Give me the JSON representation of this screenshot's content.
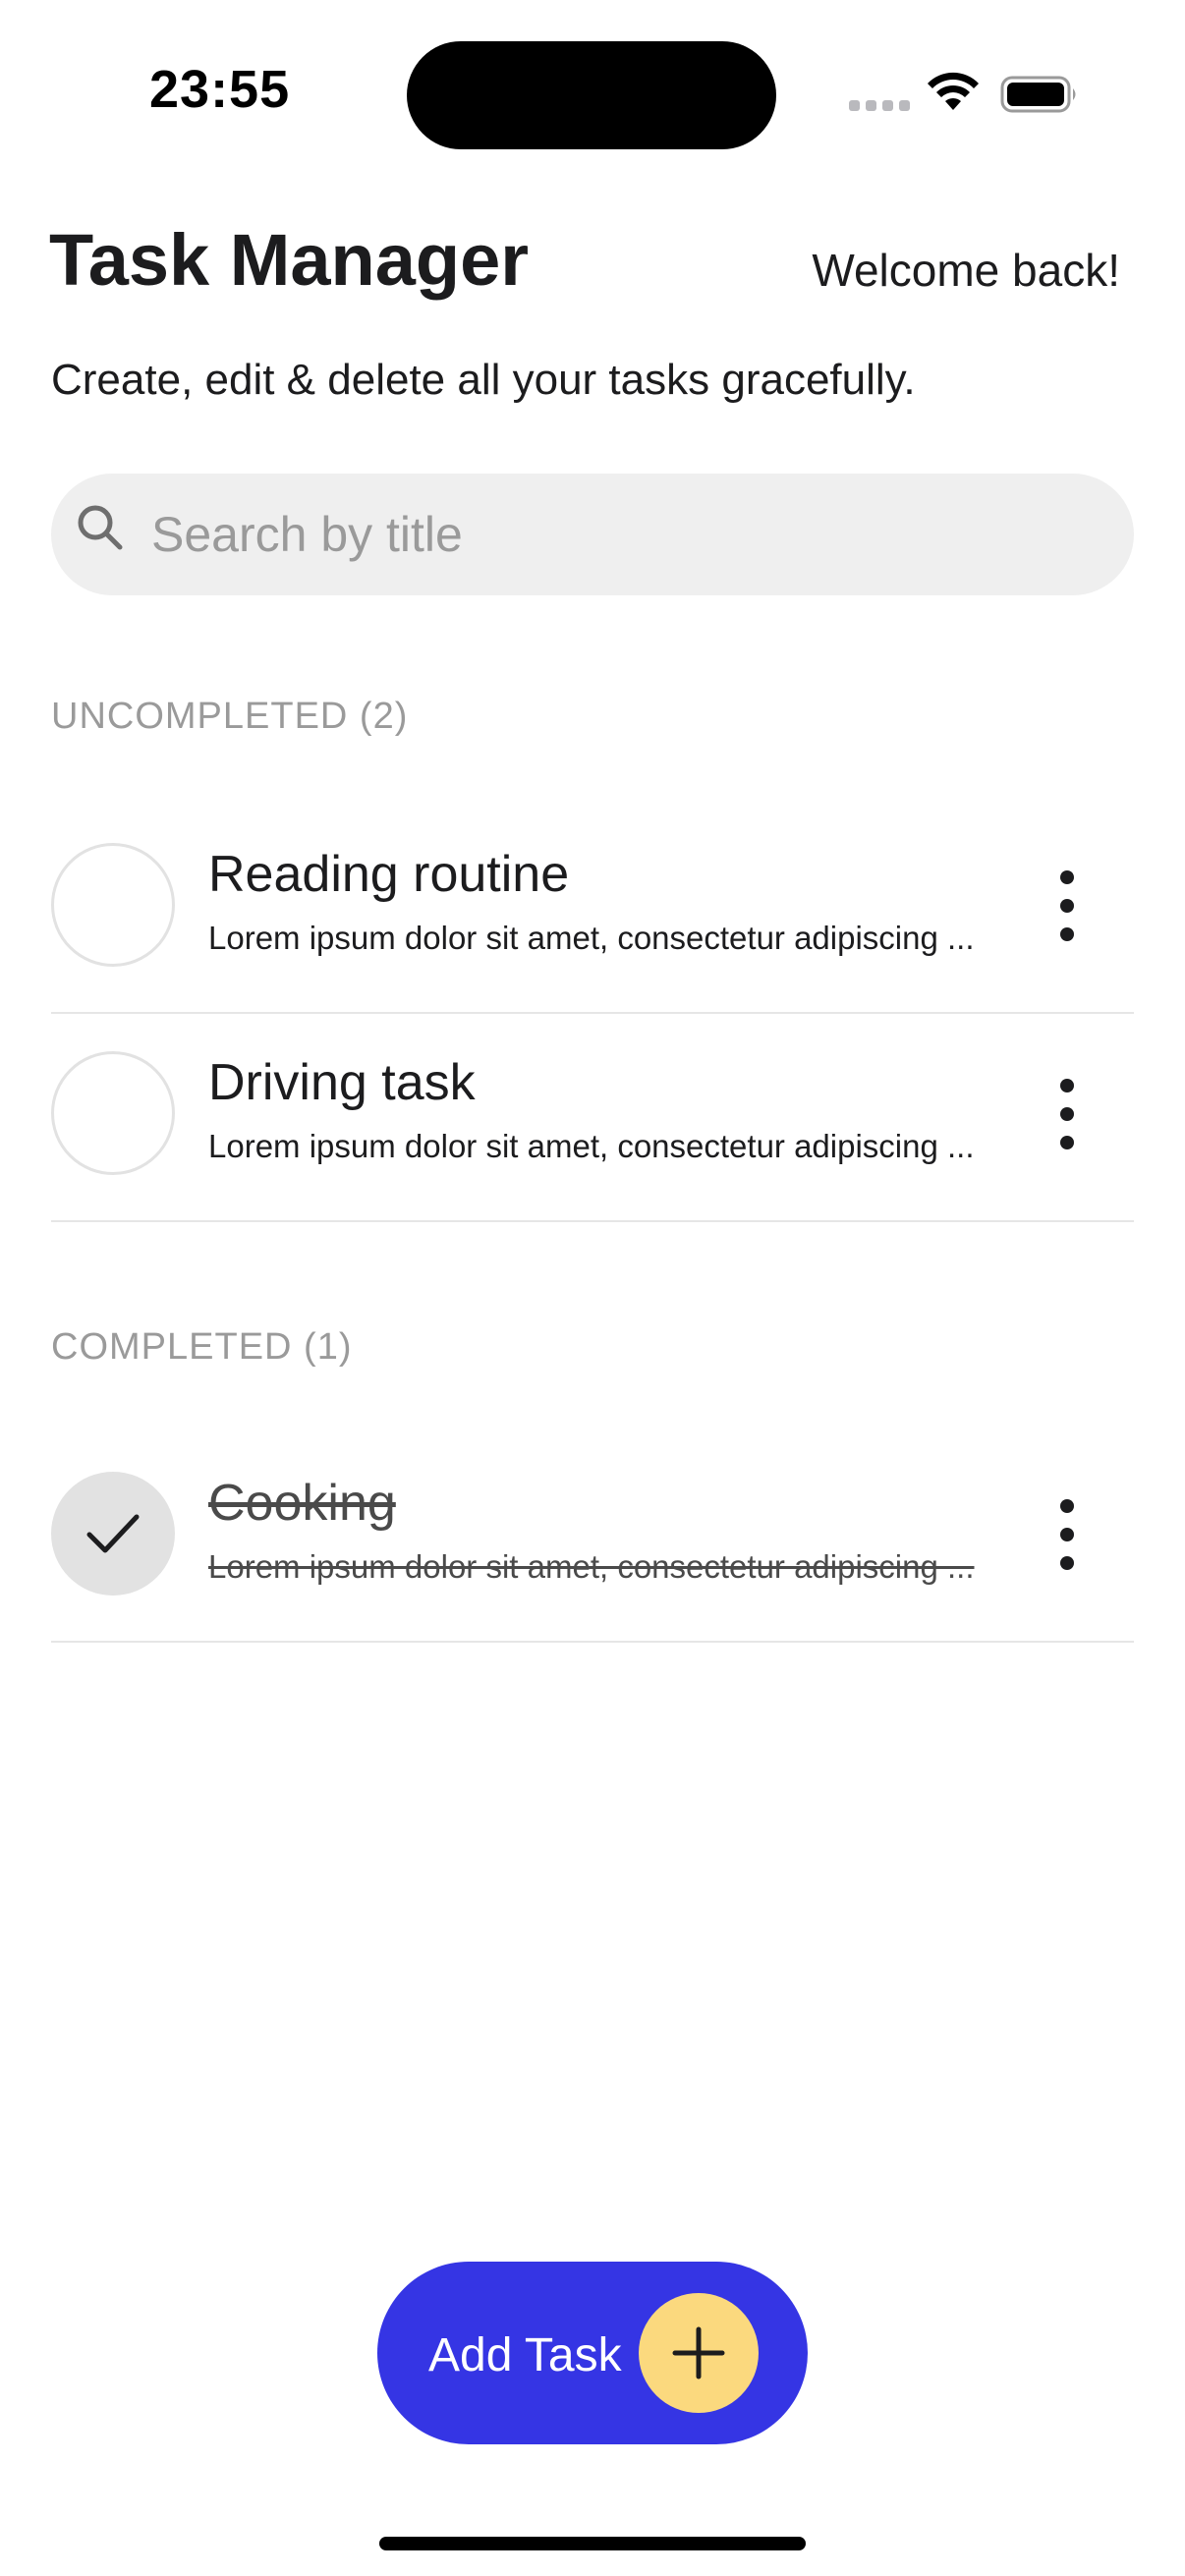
{
  "status_bar": {
    "time": "23:55",
    "icons": [
      "cellular-signal-icon",
      "wifi-icon",
      "battery-icon"
    ]
  },
  "header": {
    "title": "Task Manager",
    "welcome": "Welcome back!",
    "subtitle": "Create, edit & delete all your tasks gracefully."
  },
  "search": {
    "placeholder": "Search by title",
    "value": "",
    "icon": "search-icon"
  },
  "uncompleted": {
    "label": "UNCOMPLETED (2)",
    "tasks": [
      {
        "title": "Reading routine",
        "description": "Lorem ipsum dolor sit amet, consectetur adipiscing ...",
        "completed": false
      },
      {
        "title": "Driving task",
        "description": "Lorem ipsum dolor sit amet, consectetur adipiscing ...",
        "completed": false
      }
    ]
  },
  "completed": {
    "label": "COMPLETED (1)",
    "tasks": [
      {
        "title": "Cooking",
        "description": "Lorem ipsum dolor sit amet, consectetur adipiscing ...",
        "completed": true
      }
    ]
  },
  "add_button": {
    "label": "Add Task",
    "icon": "plus-icon"
  },
  "colors": {
    "accent": "#3535e4",
    "plus_bg": "#fbd97e",
    "search_bg": "#efefef",
    "section_label": "#9a9a9a",
    "divider": "#e6e6e6"
  }
}
